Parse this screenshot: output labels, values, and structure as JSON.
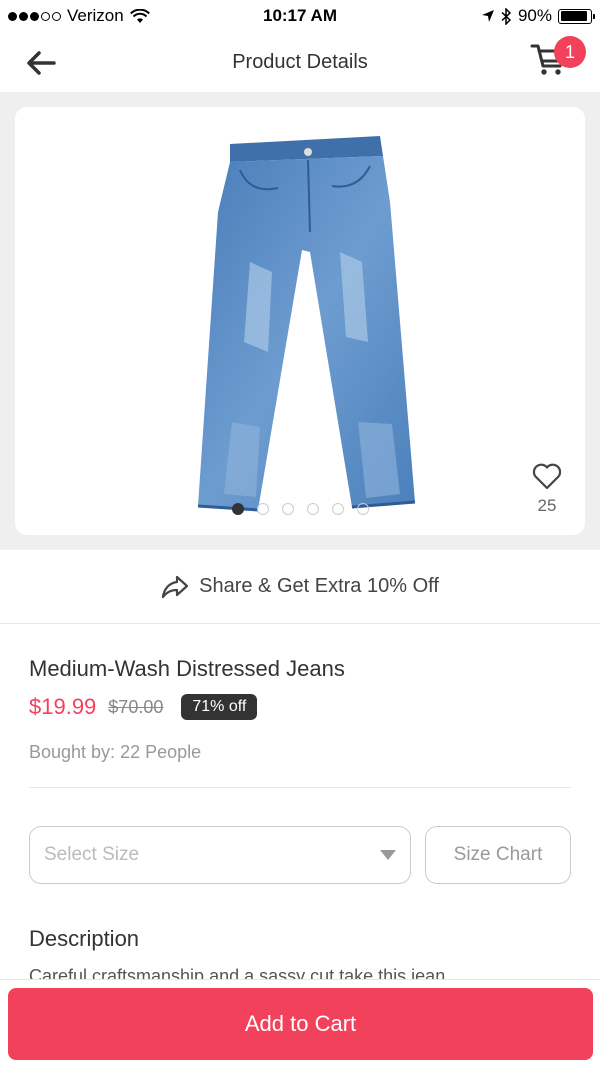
{
  "status_bar": {
    "carrier": "Verizon",
    "time": "10:17 AM",
    "battery": "90%",
    "battery_level": 0.9,
    "signal_filled": 3,
    "signal_total": 5
  },
  "nav": {
    "title": "Product Details",
    "cart_count": "1"
  },
  "gallery": {
    "image_count": 6,
    "active_index": 0,
    "favorites": "25"
  },
  "share": {
    "label": "Share & Get Extra 10% Off"
  },
  "product": {
    "name": "Medium-Wash Distressed Jeans",
    "price": "$19.99",
    "original_price": "$70.00",
    "discount": "71% off",
    "bought_by": "Bought by: 22 People"
  },
  "selectors": {
    "size_placeholder": "Select Size",
    "size_chart_label": "Size Chart"
  },
  "description": {
    "title": "Description",
    "text": "Careful craftsmanship and a sassy cut take this jean"
  },
  "cta": {
    "add_to_cart": "Add to Cart"
  },
  "colors": {
    "accent": "#f2425b",
    "denim": "#5b8dc4"
  },
  "icons": {
    "back": "arrow-left-icon",
    "cart": "cart-icon",
    "share": "share-icon",
    "favorite": "heart-icon",
    "dropdown": "triangle-down-icon"
  }
}
